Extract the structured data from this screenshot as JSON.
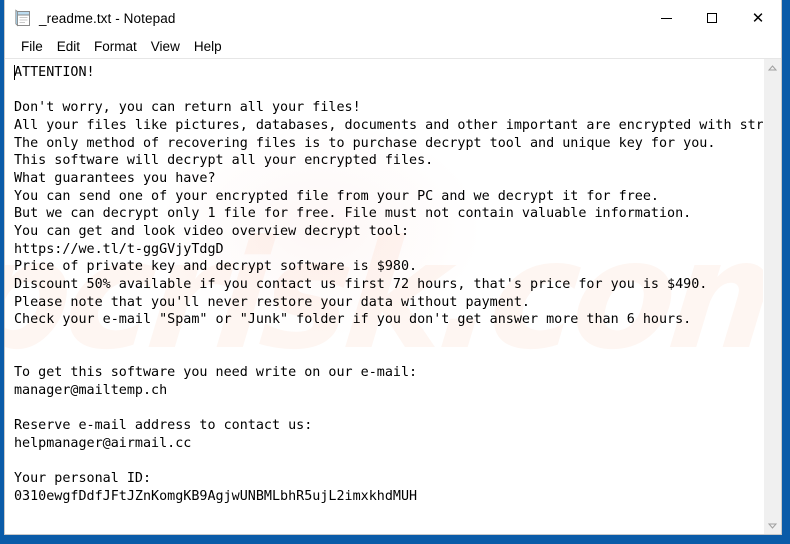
{
  "window": {
    "title": "_readme.txt - Notepad",
    "icon": "notepad-icon",
    "controls": {
      "minimize": "—",
      "maximize": "☐",
      "close": "✕"
    }
  },
  "menu": {
    "items": [
      {
        "label": "File"
      },
      {
        "label": "Edit"
      },
      {
        "label": "Format"
      },
      {
        "label": "View"
      },
      {
        "label": "Help"
      }
    ]
  },
  "document": {
    "body": "ATTENTION!\n\nDon't worry, you can return all your files!\nAll your files like pictures, databases, documents and other important are encrypted with strongest encryption and unique key.\nThe only method of recovering files is to purchase decrypt tool and unique key for you.\nThis software will decrypt all your encrypted files.\nWhat guarantees you have?\nYou can send one of your encrypted file from your PC and we decrypt it for free.\nBut we can decrypt only 1 file for free. File must not contain valuable information.\nYou can get and look video overview decrypt tool:\nhttps://we.tl/t-ggGVjyTdgD\nPrice of private key and decrypt software is $980.\nDiscount 50% available if you contact us first 72 hours, that's price for you is $490.\nPlease note that you'll never restore your data without payment.\nCheck your e-mail \"Spam\" or \"Junk\" folder if you don't get answer more than 6 hours.\n\n\nTo get this software you need write on our e-mail:\nmanager@mailtemp.ch\n\nReserve e-mail address to contact us:\nhelpmanager@airmail.cc\n\nYour personal ID:\n0310ewgfDdfJFtJZnKomgKB9AgjwUNBMLbhR5ujL2imxkhdMUH",
    "ransom_details": {
      "video_url": "https://we.tl/t-ggGVjyTdgD",
      "price_full": "$980",
      "price_discount": "$490",
      "discount_percent": "50%",
      "discount_window": "72 hours",
      "response_time": "6 hours",
      "free_decrypt_files": "1",
      "primary_email": "manager@mailtemp.ch",
      "reserve_email": "helpmanager@airmail.cc",
      "personal_id": "0310ewgfDdfJFtJZnKomgKB9AgjwUNBMLbhR5ujL2imxkhdMUH"
    }
  },
  "watermark": {
    "text": "pcrisk.com"
  },
  "scrollbar": {
    "up_arrow": "scroll-up-icon",
    "down_arrow": "scroll-down-icon"
  },
  "colors": {
    "desktop": "#0a5ba8",
    "window_bg": "#ffffff",
    "text": "#000000",
    "scrollbar_track": "#f0f0f0"
  }
}
